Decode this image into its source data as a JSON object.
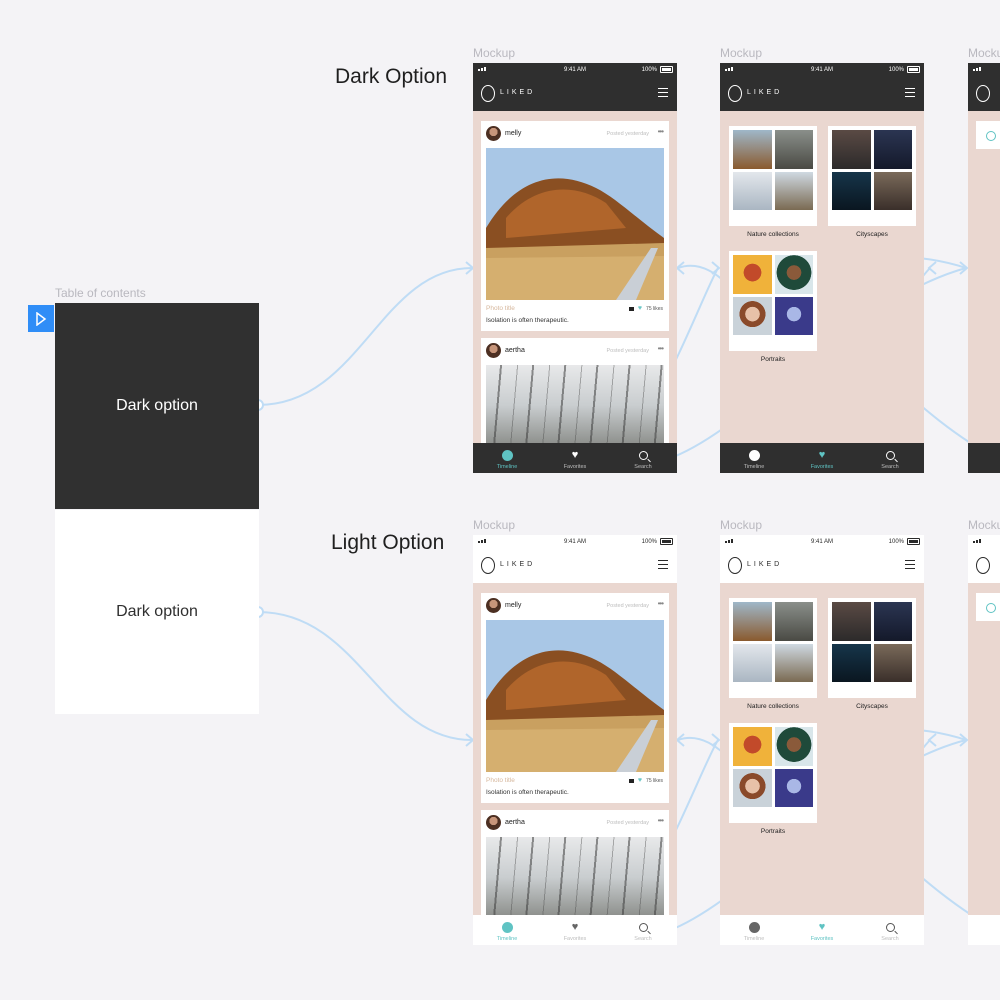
{
  "toc": {
    "title": "Table of contents",
    "dark_card_label": "Dark option",
    "light_card_label": "Dark option"
  },
  "sections": {
    "dark_label": "Dark Option",
    "light_label": "Light Option"
  },
  "frame_label": "Mockup",
  "status": {
    "time": "9:41 AM",
    "battery": "100%"
  },
  "app": {
    "brand": "LIKED"
  },
  "timeline": {
    "post1": {
      "user": "melly",
      "posted": "Posted yesterday",
      "title": "Photo title",
      "caption": "Isolation is often therapeutic.",
      "likes": "75 likes"
    },
    "post2": {
      "user": "aertha",
      "posted": "Posted yesterday"
    }
  },
  "favorites": {
    "collections": [
      "Nature collections",
      "Cityscapes",
      "Portraits"
    ]
  },
  "tabs": {
    "timeline": "Timeline",
    "favorites": "Favorites",
    "search": "Search"
  },
  "colors": {
    "accent": "#5fc3c3",
    "dark_bar": "#2f2f2f",
    "page_bg": "#ead7d0",
    "link": "#bfdcf5",
    "play": "#2f8df7"
  },
  "icons": [
    "play-icon",
    "menu-icon",
    "clock-icon",
    "heart-icon",
    "search-icon",
    "comment-icon",
    "more-icon",
    "logo-icon"
  ]
}
